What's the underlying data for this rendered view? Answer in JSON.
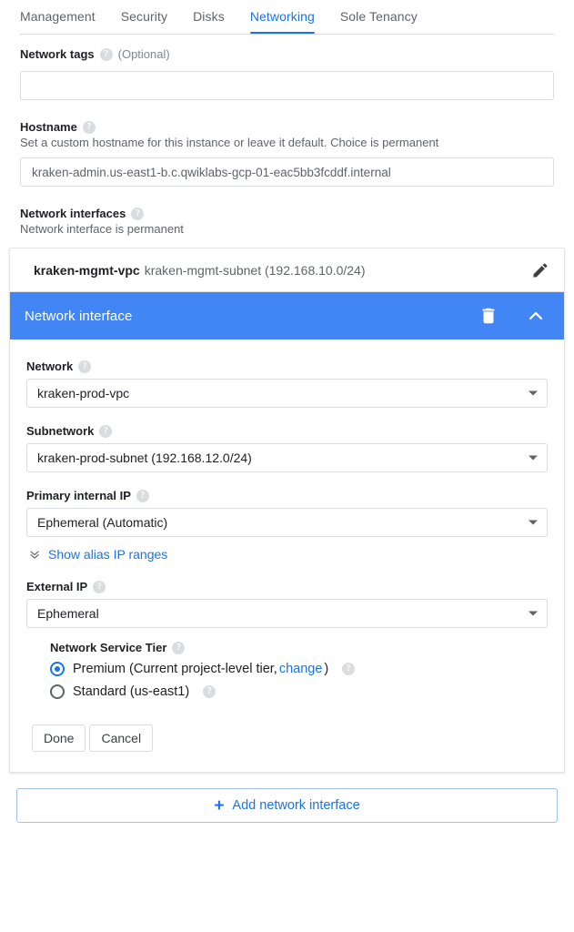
{
  "tabs": [
    {
      "label": "Management",
      "active": false
    },
    {
      "label": "Security",
      "active": false
    },
    {
      "label": "Disks",
      "active": false
    },
    {
      "label": "Networking",
      "active": true
    },
    {
      "label": "Sole Tenancy",
      "active": false
    }
  ],
  "network_tags": {
    "label": "Network tags",
    "optional": "(Optional)",
    "value": "",
    "placeholder": ""
  },
  "hostname": {
    "label": "Hostname",
    "description": "Set a custom hostname for this instance or leave it default. Choice is permanent",
    "value": "kraken-admin.us-east1-b.c.qwiklabs-gcp-01-eac5bb3fcddf.internal",
    "placeholder": "kraken-admin.us-east1-b.c.qwiklabs-gcp-01-eac5bb3fcddf.internal"
  },
  "network_interfaces": {
    "label": "Network interfaces",
    "description": "Network interface is permanent",
    "existing": {
      "network": "kraken-mgmt-vpc",
      "subnet": "kraken-mgmt-subnet (192.168.10.0/24)"
    }
  },
  "panel": {
    "title": "Network interface",
    "network": {
      "label": "Network",
      "value": "kraken-prod-vpc"
    },
    "subnetwork": {
      "label": "Subnetwork",
      "value": "kraken-prod-subnet (192.168.12.0/24)"
    },
    "primary_internal_ip": {
      "label": "Primary internal IP",
      "value": "Ephemeral (Automatic)"
    },
    "alias_link": "Show alias IP ranges",
    "external_ip": {
      "label": "External IP",
      "value": "Ephemeral"
    },
    "service_tier": {
      "label": "Network Service Tier",
      "options": [
        {
          "prefix": "Premium (Current project-level tier, ",
          "link": "change",
          "suffix": ")",
          "selected": true
        },
        {
          "prefix": "Standard (us-east1)",
          "link": "",
          "suffix": "",
          "selected": false
        }
      ]
    },
    "done_label": "Done",
    "cancel_label": "Cancel"
  },
  "add_interface": {
    "label": "Add network interface",
    "plus": "+"
  },
  "colors": {
    "accent": "#1a73e8",
    "panel_header": "#4285f4",
    "border": "#dadce0",
    "text": "#3c4043",
    "muted": "#5f6368"
  }
}
